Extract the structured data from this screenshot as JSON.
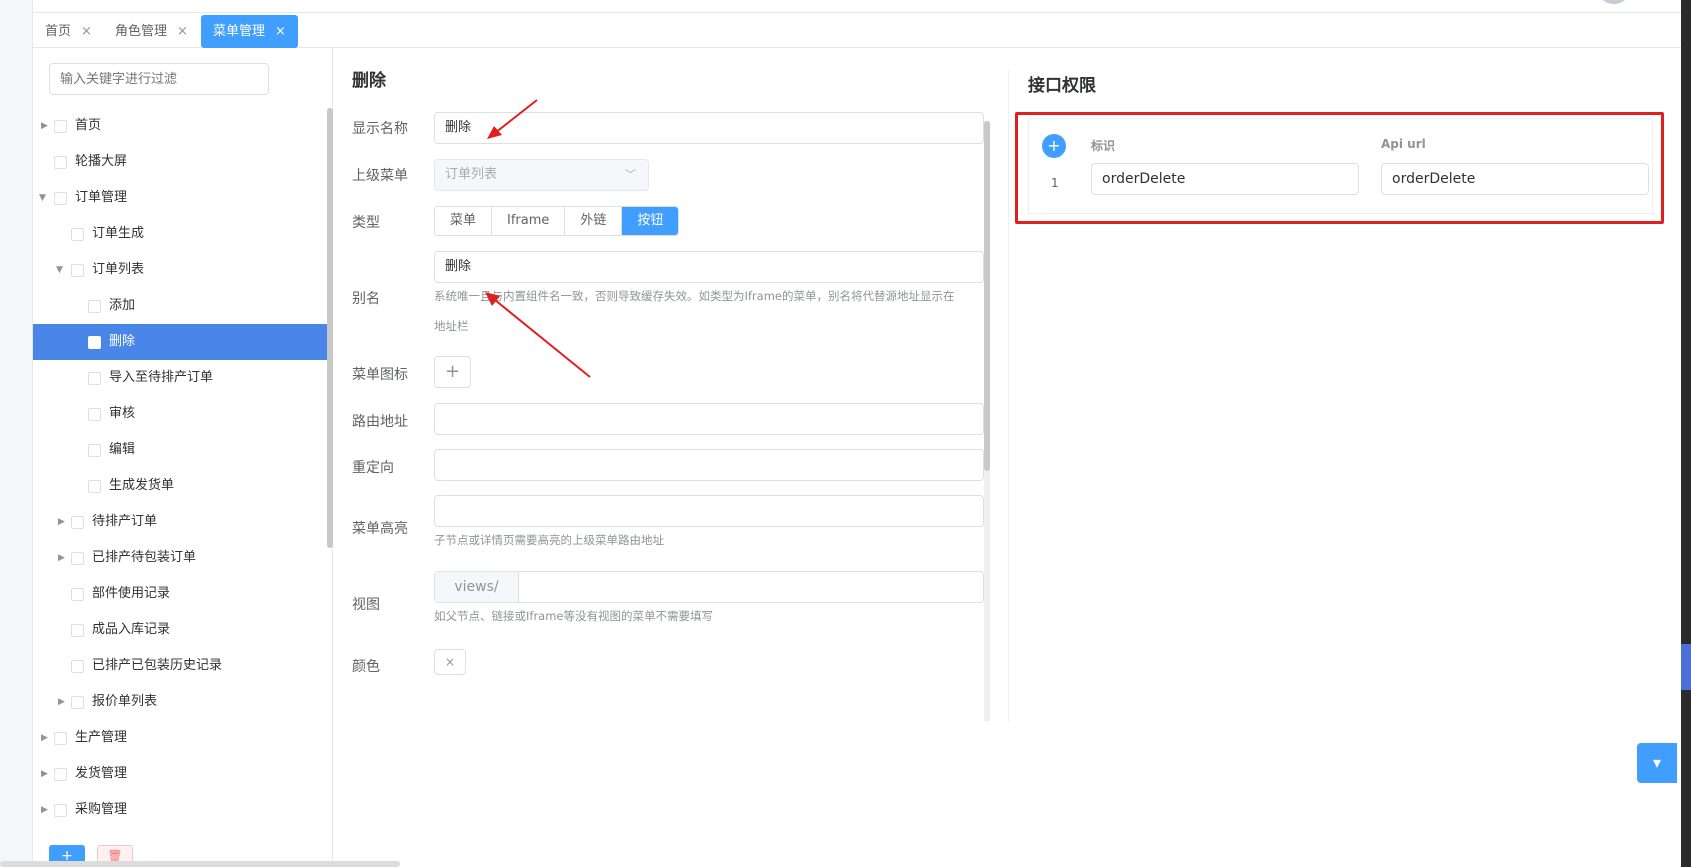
{
  "tabs": [
    {
      "label": "首页"
    },
    {
      "label": "角色管理"
    },
    {
      "label": "菜单管理",
      "active": true
    }
  ],
  "tab_close_glyph": "×",
  "tree": {
    "filter_placeholder": "输入关键字进行过滤",
    "nodes": [
      {
        "label": "首页"
      },
      {
        "label": "轮播大屏"
      },
      {
        "label": "订单管理"
      },
      {
        "label": "订单生成"
      },
      {
        "label": "订单列表"
      },
      {
        "label": "添加"
      },
      {
        "label": "删除",
        "selected": true
      },
      {
        "label": "导入至待排产订单"
      },
      {
        "label": "审核"
      },
      {
        "label": "编辑"
      },
      {
        "label": "生成发货单"
      },
      {
        "label": "待排产订单"
      },
      {
        "label": "已排产待包装订单"
      },
      {
        "label": "部件使用记录"
      },
      {
        "label": "成品入库记录"
      },
      {
        "label": "已排产已包装历史记录"
      },
      {
        "label": "报价单列表"
      },
      {
        "label": "生产管理"
      },
      {
        "label": "发货管理"
      },
      {
        "label": "采购管理"
      }
    ],
    "add_button": "+",
    "delete_button": "🗑"
  },
  "form": {
    "title": "删除",
    "display_name_label": "显示名称",
    "display_name_value": "删除",
    "parent_menu_label": "上级菜单",
    "parent_menu_value": "订单列表",
    "type_label": "类型",
    "type_options": [
      "菜单",
      "Iframe",
      "外链",
      "按钮"
    ],
    "type_selected": "按钮",
    "alias_label": "别名",
    "alias_value": "删除",
    "alias_help_1": "系统唯一且与内置组件名一致，否则导致缓存失效。如类型为Iframe的菜单，别名将代替源地址显示在",
    "alias_help_2": "地址栏",
    "icon_label": "菜单图标",
    "icon_plus": "+",
    "route_label": "路由地址",
    "route_value": "",
    "redirect_label": "重定向",
    "redirect_value": "",
    "highlight_label": "菜单高亮",
    "highlight_value": "",
    "highlight_help": "子节点或详情页需要高亮的上级菜单路由地址",
    "view_label": "视图",
    "view_prefix": "views/",
    "view_value": "",
    "view_help": "如父节点、链接或Iframe等没有视图的菜单不需要填写",
    "color_label": "颜色",
    "color_clear": "×"
  },
  "api": {
    "title": "接口权限",
    "col_add": "+",
    "col_key": "标识",
    "col_url": "Api url",
    "rows": [
      {
        "index": "1",
        "key": "orderDelete",
        "url": "orderDelete"
      }
    ]
  },
  "colors": {
    "accent": "#409eff",
    "selected_row": "#4a86e8",
    "highlight_border": "#e02020",
    "annotation_arrow": "#e02020"
  }
}
